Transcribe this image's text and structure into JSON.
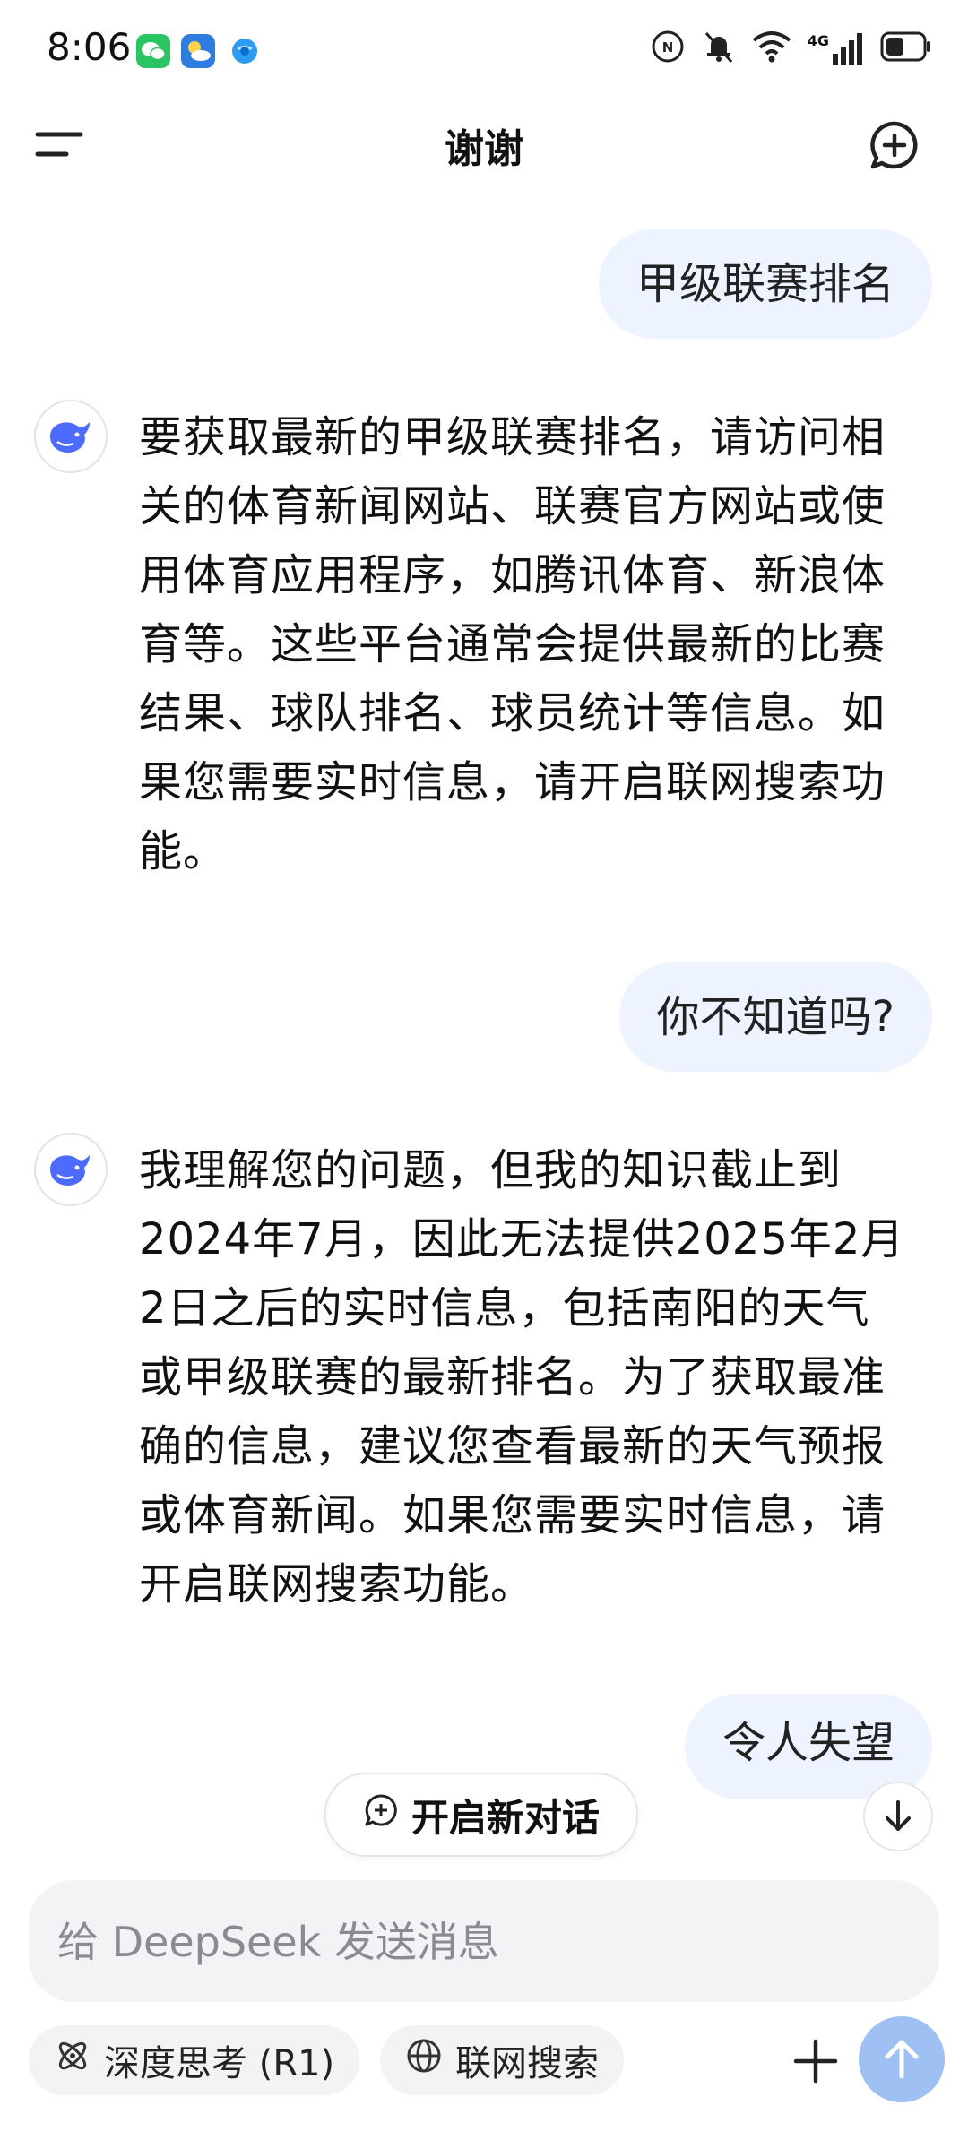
{
  "status_bar": {
    "time": "8:06",
    "network_label": "4G",
    "battery_level": 0.5,
    "icons": [
      "wechat-icon",
      "weather-icon",
      "browser-icon",
      "nfc-icon",
      "mute-bell-icon",
      "wifi-icon",
      "signal-icon",
      "battery-icon"
    ]
  },
  "header": {
    "title": "谢谢"
  },
  "conversation": {
    "user_1": "甲级联赛排名",
    "ai_1": "要获取最新的甲级联赛排名，请访问相关的体育新闻网站、联赛官方网站或使用体育应用程序，如腾讯体育、新浪体育等。这些平台通常会提供最新的比赛结果、球队排名、球员统计等信息。如果您需要实时信息，请开启联网搜索功能。",
    "user_2": "你不知道吗?",
    "ai_2": "我理解您的问题，但我的知识截止到2024年7月，因此无法提供2025年2月2日之后的实时信息，包括南阳的天气或甲级联赛的最新排名。为了获取最准确的信息，建议您查看最新的天气预报或体育新闻。如果您需要实时信息，请开启联网搜索功能。",
    "user_3": "令人失望"
  },
  "floating": {
    "new_chat_label": "开启新对话"
  },
  "composer": {
    "placeholder": "给 DeepSeek 发送消息",
    "value": "",
    "deep_think_label": "深度思考 (R1)",
    "web_search_label": "联网搜索"
  },
  "colors": {
    "accent": "#4d6bfe",
    "user_bubble": "#eef4ff",
    "send_button": "#9ec0f2"
  }
}
